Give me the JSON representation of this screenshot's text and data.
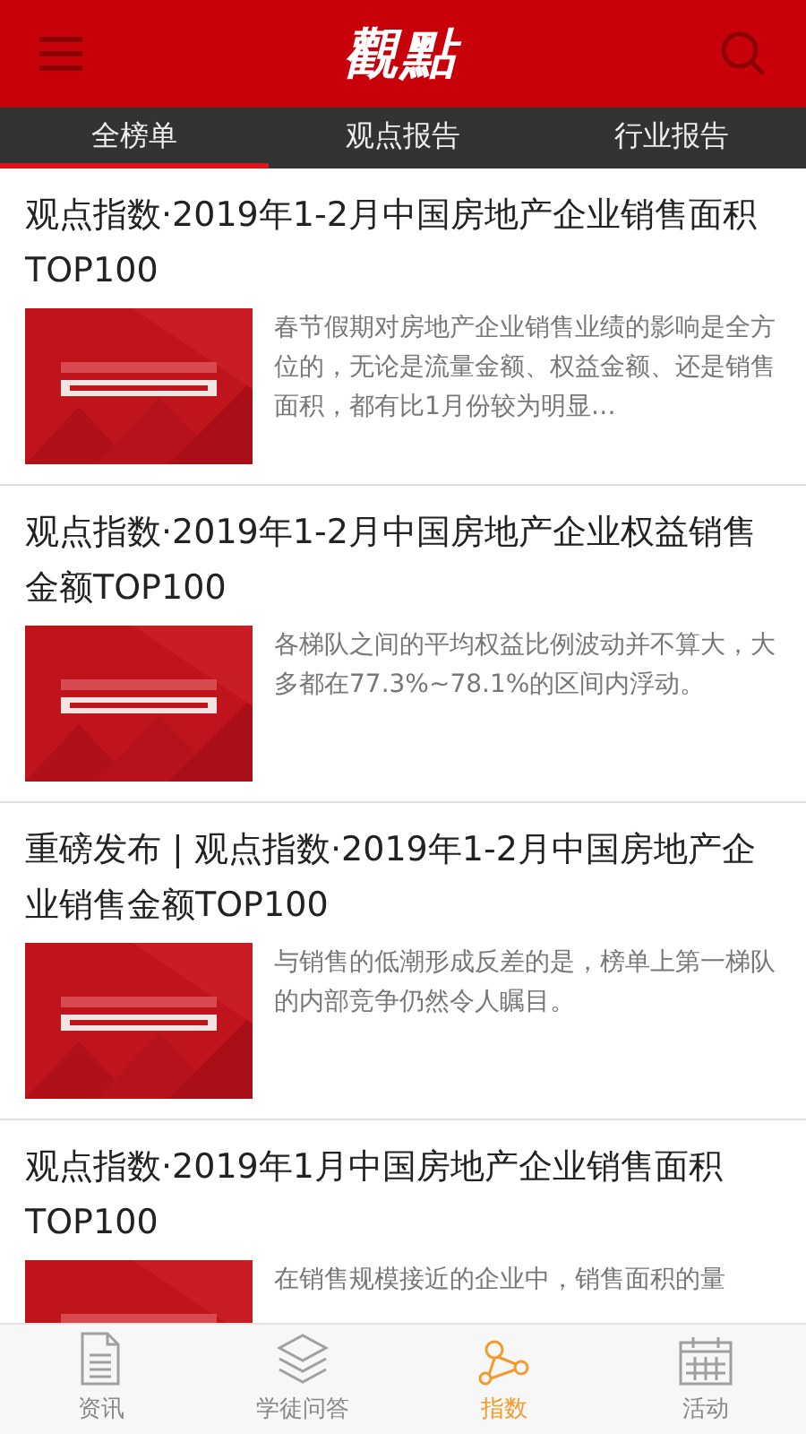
{
  "header": {
    "logo": "觀點"
  },
  "tabs": [
    {
      "label": "全榜单",
      "selected": true
    },
    {
      "label": "观点报告",
      "selected": false
    },
    {
      "label": "行业报告",
      "selected": false
    }
  ],
  "articles": [
    {
      "title": "观点指数·2019年1-2月中国房地产企业销售面积TOP100",
      "summary": "春节假期对房地产企业销售业绩的影响是全方位的，无论是流量金额、权益金额、还是销售面积，都有比1月份较为明显…"
    },
    {
      "title": "观点指数·2019年1-2月中国房地产企业权益销售金额TOP100",
      "summary": "各梯队之间的平均权益比例波动并不算大，大多都在77.3%~78.1%的区间内浮动。"
    },
    {
      "title": "重磅发布 | 观点指数·2019年1-2月中国房地产企业销售金额TOP100",
      "summary": "与销售的低潮形成反差的是，榜单上第一梯队的内部竞争仍然令人瞩目。"
    },
    {
      "title": "观点指数·2019年1月中国房地产企业销售面积TOP100",
      "summary": "在销售规模接近的企业中，销售面积的量"
    }
  ],
  "bottom_nav": [
    {
      "label": "资讯",
      "kind": "document",
      "selected": false
    },
    {
      "label": "学徒问答",
      "kind": "layers",
      "selected": false
    },
    {
      "label": "指数",
      "kind": "share",
      "selected": true
    },
    {
      "label": "活动",
      "kind": "calendar",
      "selected": false
    }
  ]
}
